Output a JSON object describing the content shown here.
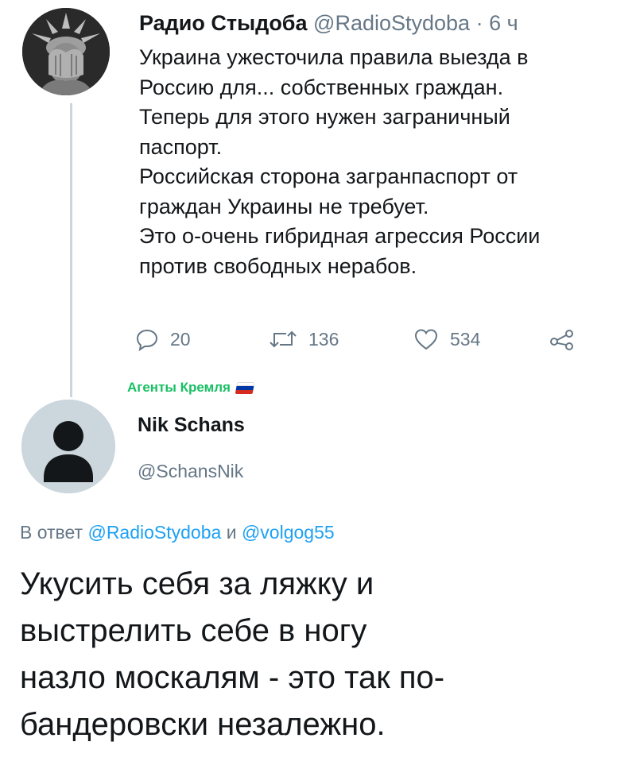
{
  "tweet": {
    "author_name": "Радио Стыдоба",
    "author_handle": "@RadioStydoba",
    "separator": " · ",
    "time": "6 ч",
    "lines": [
      "Украина ужесточила правила выезда в",
      "Россию для... собственных граждан.",
      "Теперь для этого нужен заграничный",
      "паспорт.",
      "Российская сторона загранпаспорт от",
      "граждан Украины не требует.",
      "Это о-очень гибридная агрессия России",
      "против свободных нерабов."
    ],
    "reply_count": "20",
    "retweet_count": "136",
    "like_count": "534"
  },
  "badge": {
    "label": "Агенты Кремля",
    "flag_colors": [
      "#ffffff",
      "#0039a6",
      "#d52b1e"
    ]
  },
  "reply": {
    "author_name": "Nik Schans",
    "author_handle": "@SchansNik",
    "reply_prefix": "В ответ ",
    "mention1": "@RadioStydoba",
    "conjunction": " и ",
    "mention2": "@volgog55",
    "lines": [
      "Укусить себя за ляжку и",
      "выстрелить себе в ногу",
      "назло москалям - это так по-",
      "бандеровски незалежно."
    ]
  },
  "colors": {
    "text": "#14171a",
    "secondary": "#657786",
    "link": "#1da1f2",
    "badge": "#17bf63",
    "default_avatar_bg": "#ccd6dd"
  },
  "icons": [
    "reply-icon",
    "retweet-icon",
    "like-icon",
    "share-icon",
    "default-avatar-icon"
  ]
}
